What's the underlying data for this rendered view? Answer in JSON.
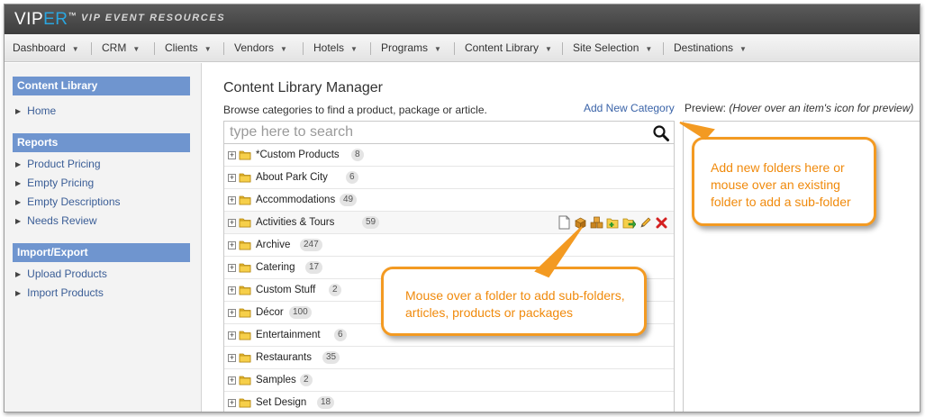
{
  "header": {
    "logo_main": "VIP",
    "logo_accent": "ER",
    "logo_tm": "™",
    "tagline": "VIP EVENT RESOURCES"
  },
  "nav": {
    "items": [
      {
        "label": "Dashboard"
      },
      {
        "label": "CRM"
      },
      {
        "label": "Clients"
      },
      {
        "label": "Vendors"
      },
      {
        "label": "Hotels"
      },
      {
        "label": "Programs"
      },
      {
        "label": "Content Library"
      },
      {
        "label": "Site Selection"
      },
      {
        "label": "Destinations"
      }
    ]
  },
  "sidebar": {
    "sections": [
      {
        "heading": "Content Library",
        "links": [
          "Home"
        ]
      },
      {
        "heading": "Reports",
        "links": [
          "Product Pricing",
          "Empty Pricing",
          "Empty Descriptions",
          "Needs Review"
        ]
      },
      {
        "heading": "Import/Export",
        "links": [
          "Upload Products",
          "Import Products"
        ]
      }
    ]
  },
  "main": {
    "title": "Content Library Manager",
    "subtitle": "Browse categories to find a product, package or article.",
    "add_category_label": "Add New Category",
    "preview_label": "Preview:",
    "preview_hint": "(Hover over an item's icon for preview)",
    "search": {
      "placeholder": "type here to search",
      "value": ""
    },
    "categories": [
      {
        "label": "*Custom Products",
        "count": "8"
      },
      {
        "label": "About Park City",
        "count": "6"
      },
      {
        "label": "Accommodations",
        "count": "49"
      },
      {
        "label": "Activities & Tours",
        "count": "59"
      },
      {
        "label": "Archive",
        "count": "247"
      },
      {
        "label": "Catering",
        "count": "17"
      },
      {
        "label": "Custom Stuff",
        "count": "2"
      },
      {
        "label": "Décor",
        "count": "100"
      },
      {
        "label": "Entertainment",
        "count": "6"
      },
      {
        "label": "Restaurants",
        "count": "35"
      },
      {
        "label": "Samples",
        "count": "2"
      },
      {
        "label": "Set Design",
        "count": "18"
      }
    ]
  },
  "callouts": {
    "top": [
      "Add new folders here or",
      "mouse over an existing",
      "folder to add a sub-folder"
    ],
    "bottom": [
      "Mouse over a folder to add sub-folders,",
      "articles, products or packages"
    ]
  },
  "colors": {
    "accent": "#6f95cf",
    "link": "#3a63a8",
    "callout": "#f39a22",
    "logo_accent": "#2aa6e0"
  }
}
